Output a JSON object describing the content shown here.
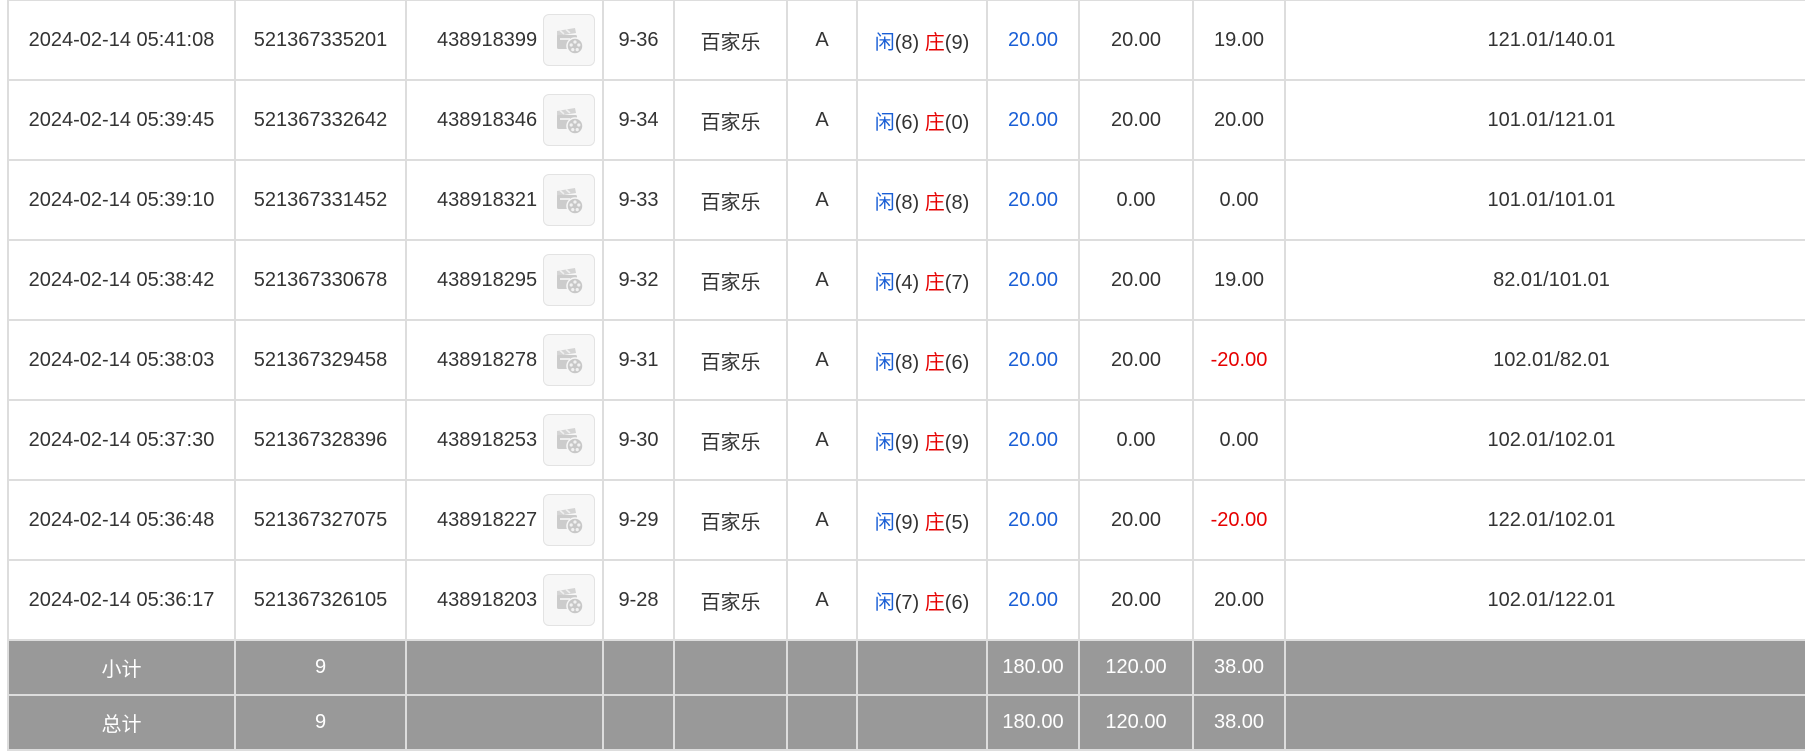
{
  "table": {
    "rows": [
      {
        "time": "2024-02-14 05:41:08",
        "order_no": "521367335201",
        "game_no": "438918399",
        "shoe": "9-36",
        "game_type": "百家乐",
        "table": "A",
        "player_label": "闲",
        "player_value": "(8)",
        "banker_label": "庄",
        "banker_value": "(9)",
        "bet": "20.00",
        "valid": "20.00",
        "winloss": "19.00",
        "winloss_negative": false,
        "balance": "121.01/140.01"
      },
      {
        "time": "2024-02-14 05:39:45",
        "order_no": "521367332642",
        "game_no": "438918346",
        "shoe": "9-34",
        "game_type": "百家乐",
        "table": "A",
        "player_label": "闲",
        "player_value": "(6)",
        "banker_label": "庄",
        "banker_value": "(0)",
        "bet": "20.00",
        "valid": "20.00",
        "winloss": "20.00",
        "winloss_negative": false,
        "balance": "101.01/121.01"
      },
      {
        "time": "2024-02-14 05:39:10",
        "order_no": "521367331452",
        "game_no": "438918321",
        "shoe": "9-33",
        "game_type": "百家乐",
        "table": "A",
        "player_label": "闲",
        "player_value": "(8)",
        "banker_label": "庄",
        "banker_value": "(8)",
        "bet": "20.00",
        "valid": "0.00",
        "winloss": "0.00",
        "winloss_negative": false,
        "balance": "101.01/101.01"
      },
      {
        "time": "2024-02-14 05:38:42",
        "order_no": "521367330678",
        "game_no": "438918295",
        "shoe": "9-32",
        "game_type": "百家乐",
        "table": "A",
        "player_label": "闲",
        "player_value": "(4)",
        "banker_label": "庄",
        "banker_value": "(7)",
        "bet": "20.00",
        "valid": "20.00",
        "winloss": "19.00",
        "winloss_negative": false,
        "balance": "82.01/101.01"
      },
      {
        "time": "2024-02-14 05:38:03",
        "order_no": "521367329458",
        "game_no": "438918278",
        "shoe": "9-31",
        "game_type": "百家乐",
        "table": "A",
        "player_label": "闲",
        "player_value": "(8)",
        "banker_label": "庄",
        "banker_value": "(6)",
        "bet": "20.00",
        "valid": "20.00",
        "winloss": "-20.00",
        "winloss_negative": true,
        "balance": "102.01/82.01"
      },
      {
        "time": "2024-02-14 05:37:30",
        "order_no": "521367328396",
        "game_no": "438918253",
        "shoe": "9-30",
        "game_type": "百家乐",
        "table": "A",
        "player_label": "闲",
        "player_value": "(9)",
        "banker_label": "庄",
        "banker_value": "(9)",
        "bet": "20.00",
        "valid": "0.00",
        "winloss": "0.00",
        "winloss_negative": false,
        "balance": "102.01/102.01"
      },
      {
        "time": "2024-02-14 05:36:48",
        "order_no": "521367327075",
        "game_no": "438918227",
        "shoe": "9-29",
        "game_type": "百家乐",
        "table": "A",
        "player_label": "闲",
        "player_value": "(9)",
        "banker_label": "庄",
        "banker_value": "(5)",
        "bet": "20.00",
        "valid": "20.00",
        "winloss": "-20.00",
        "winloss_negative": true,
        "balance": "122.01/102.01"
      },
      {
        "time": "2024-02-14 05:36:17",
        "order_no": "521367326105",
        "game_no": "438918203",
        "shoe": "9-28",
        "game_type": "百家乐",
        "table": "A",
        "player_label": "闲",
        "player_value": "(7)",
        "banker_label": "庄",
        "banker_value": "(6)",
        "bet": "20.00",
        "valid": "20.00",
        "winloss": "20.00",
        "winloss_negative": false,
        "balance": "102.01/122.01"
      }
    ],
    "subtotal": {
      "label": "小计",
      "count": "9",
      "bet": "180.00",
      "valid": "120.00",
      "winloss": "38.00"
    },
    "total": {
      "label": "总计",
      "count": "9",
      "bet": "180.00",
      "valid": "120.00",
      "winloss": "38.00"
    }
  },
  "icons": {
    "replay": "video-replay-icon"
  },
  "colors": {
    "player": "#1a5fd6",
    "banker": "#e60000",
    "negative": "#e60000",
    "bet": "#1a5fd6",
    "summary_bg": "#999999"
  }
}
